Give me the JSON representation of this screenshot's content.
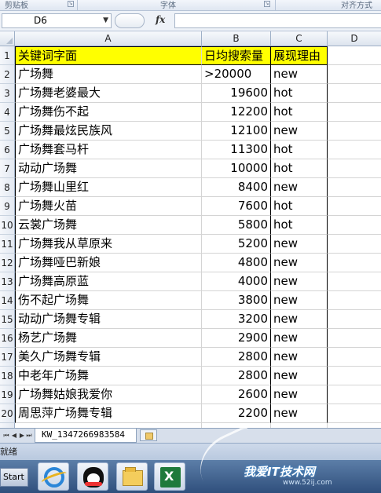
{
  "ribbon": {
    "groups": [
      "剪贴板",
      "字体",
      "对齐方式"
    ]
  },
  "formula_bar": {
    "name_box": "D6",
    "fx_label": "fx",
    "formula": ""
  },
  "columns": [
    "A",
    "B",
    "C",
    "D"
  ],
  "sheet": {
    "header": {
      "row": "1",
      "a": "关键词字面",
      "b": "日均搜索量",
      "c": "展现理由"
    },
    "rows": [
      {
        "row": "2",
        "a": "广场舞",
        "b": ">20000",
        "c": "new"
      },
      {
        "row": "3",
        "a": "广场舞老婆最大",
        "b": "19600",
        "c": "hot"
      },
      {
        "row": "4",
        "a": "广场舞伤不起",
        "b": "12200",
        "c": "hot"
      },
      {
        "row": "5",
        "a": "广场舞最炫民族风",
        "b": "12100",
        "c": "new"
      },
      {
        "row": "6",
        "a": "广场舞套马杆",
        "b": "11300",
        "c": "hot"
      },
      {
        "row": "7",
        "a": "动动广场舞",
        "b": "10000",
        "c": "hot"
      },
      {
        "row": "8",
        "a": "广场舞山里红",
        "b": "8400",
        "c": "new"
      },
      {
        "row": "9",
        "a": "广场舞火苗",
        "b": "7600",
        "c": "hot"
      },
      {
        "row": "10",
        "a": "云裳广场舞",
        "b": "5800",
        "c": "hot"
      },
      {
        "row": "11",
        "a": "广场舞我从草原来",
        "b": "5200",
        "c": "new"
      },
      {
        "row": "12",
        "a": "广场舞哑巴新娘",
        "b": "4800",
        "c": "new"
      },
      {
        "row": "13",
        "a": "广场舞高原蓝",
        "b": "4000",
        "c": "new"
      },
      {
        "row": "14",
        "a": "伤不起广场舞",
        "b": "3800",
        "c": "new"
      },
      {
        "row": "15",
        "a": "动动广场舞专辑",
        "b": "3200",
        "c": "new"
      },
      {
        "row": "16",
        "a": "杨艺广场舞",
        "b": "2900",
        "c": "new"
      },
      {
        "row": "17",
        "a": "美久广场舞专辑",
        "b": "2800",
        "c": "new"
      },
      {
        "row": "18",
        "a": "中老年广场舞",
        "b": "2800",
        "c": "new"
      },
      {
        "row": "19",
        "a": "广场舞姑娘我爱你",
        "b": "2600",
        "c": "new"
      },
      {
        "row": "20",
        "a": "周思萍广场舞专辑",
        "b": "2200",
        "c": "new"
      }
    ]
  },
  "tabs": {
    "sheet_name": "KW_1347266983584"
  },
  "status_bar": {
    "text": "就绪"
  },
  "taskbar": {
    "start_label": "Start"
  },
  "watermark": {
    "title": "我爱IT技术网",
    "url": "www.52ij.com"
  }
}
